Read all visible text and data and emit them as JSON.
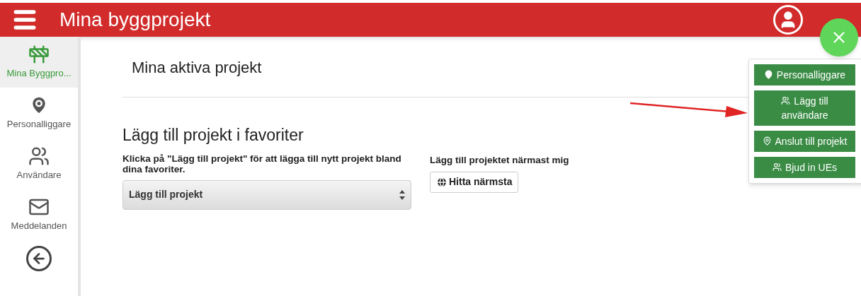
{
  "header": {
    "title": "Mina byggprojekt"
  },
  "sidebar": {
    "items": [
      {
        "label": "Mina Byggpro...",
        "kind": "barrier",
        "selected": true
      },
      {
        "label": "Personalliggare",
        "kind": "pin",
        "selected": false
      },
      {
        "label": "Användare",
        "kind": "workers",
        "selected": false
      },
      {
        "label": "Meddelanden",
        "kind": "mail",
        "selected": false
      }
    ]
  },
  "page": {
    "title": "Mina aktiva projekt"
  },
  "favorites": {
    "heading": "Lägg till projekt i favoriter",
    "description": "Klicka på \"Lägg till projekt\" för att lägga till nytt projekt bland dina favoriter.",
    "select": {
      "value": "Lägg till projekt"
    },
    "nearest_label": "Lägg till projektet närmast mig",
    "nearest_button": "Hitta närmsta"
  },
  "fab_menu": {
    "items": [
      {
        "label": "Personalliggare",
        "kind": "pin"
      },
      {
        "label": "Lägg till användare",
        "kind": "workers"
      },
      {
        "label": "Anslut till projekt",
        "kind": "map-pin"
      },
      {
        "label": "Bjud in UEs",
        "kind": "workers"
      }
    ]
  }
}
